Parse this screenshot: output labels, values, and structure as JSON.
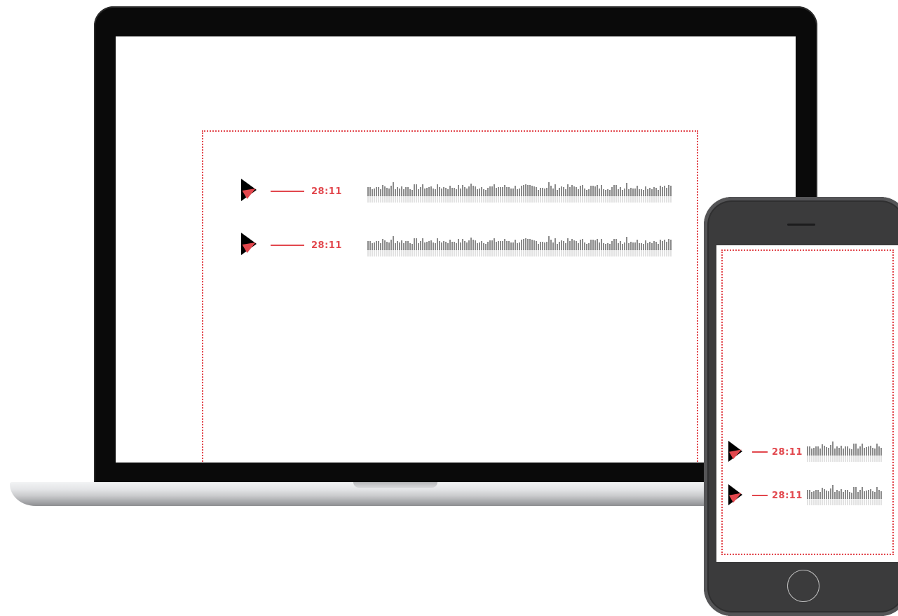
{
  "laptop": {
    "tracks": [
      {
        "duration": "28:11",
        "play_icon": "play-icon"
      },
      {
        "duration": "28:11",
        "play_icon": "play-icon"
      }
    ]
  },
  "phone": {
    "tracks": [
      {
        "duration": "28:11",
        "play_icon": "play-icon"
      },
      {
        "duration": "28:11",
        "play_icon": "play-icon"
      }
    ]
  },
  "colors": {
    "accent": "#e2474d",
    "play": "#000000",
    "waveform": "#8a8a8a",
    "waveform_reflection": "#e2e2e2"
  }
}
